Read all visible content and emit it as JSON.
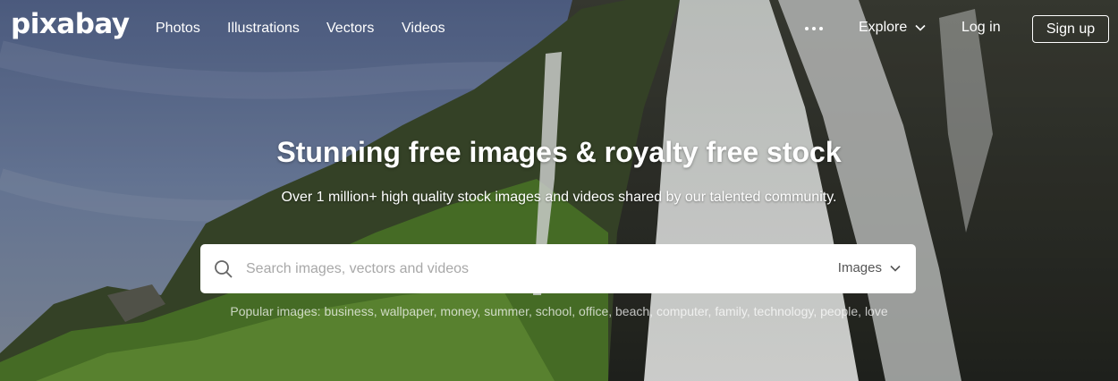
{
  "brand": {
    "logo": "pixabay"
  },
  "nav": {
    "links": [
      "Photos",
      "Illustrations",
      "Vectors",
      "Videos"
    ],
    "more_icon": "more-horizontal-icon",
    "explore": "Explore",
    "login": "Log in",
    "signup": "Sign up"
  },
  "hero": {
    "title": "Stunning free images & royalty free stock",
    "subtitle": "Over 1 million+ high quality stock images and videos shared by our talented community."
  },
  "search": {
    "placeholder": "Search images, vectors and videos",
    "type_selected": "Images",
    "icon": "search-icon"
  },
  "popular": {
    "label": "Popular images:",
    "terms": [
      "business",
      "wallpaper",
      "money",
      "summer",
      "school",
      "office",
      "beach",
      "computer",
      "family",
      "technology",
      "people",
      "love"
    ]
  },
  "colors": {
    "sky": "#6d7fa4",
    "cliff": "#3c4a2c",
    "grass": "#4f7a2b",
    "waterfall": "#e8ebea",
    "search_bg": "#ffffff",
    "placeholder": "#a8a8a8"
  }
}
